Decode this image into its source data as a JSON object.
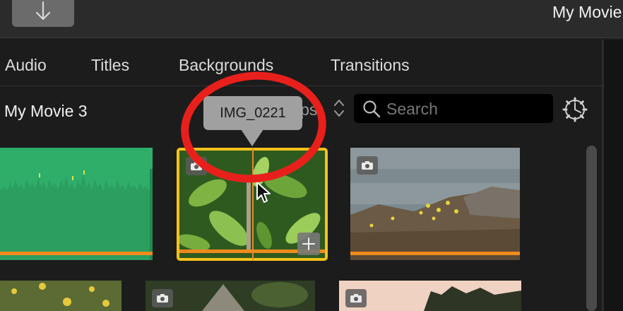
{
  "window": {
    "title": "My Movie"
  },
  "toolbar": {
    "download_icon": "arrow-down-icon"
  },
  "tabs": [
    {
      "label": "Audio"
    },
    {
      "label": "Titles"
    },
    {
      "label": "Backgrounds"
    },
    {
      "label": "Transitions"
    }
  ],
  "browser": {
    "library_title": "My Movie 3",
    "clips_filter": "ips",
    "search": {
      "placeholder": "Search",
      "value": ""
    },
    "settings_icon": "gear-icon"
  },
  "tooltip": {
    "text": "IMG_0221"
  },
  "colors": {
    "selection": "#f5c21b",
    "used_bar": "#f08a1c",
    "annotation": "#e8201c",
    "audio_clip": "#2fae6a"
  }
}
